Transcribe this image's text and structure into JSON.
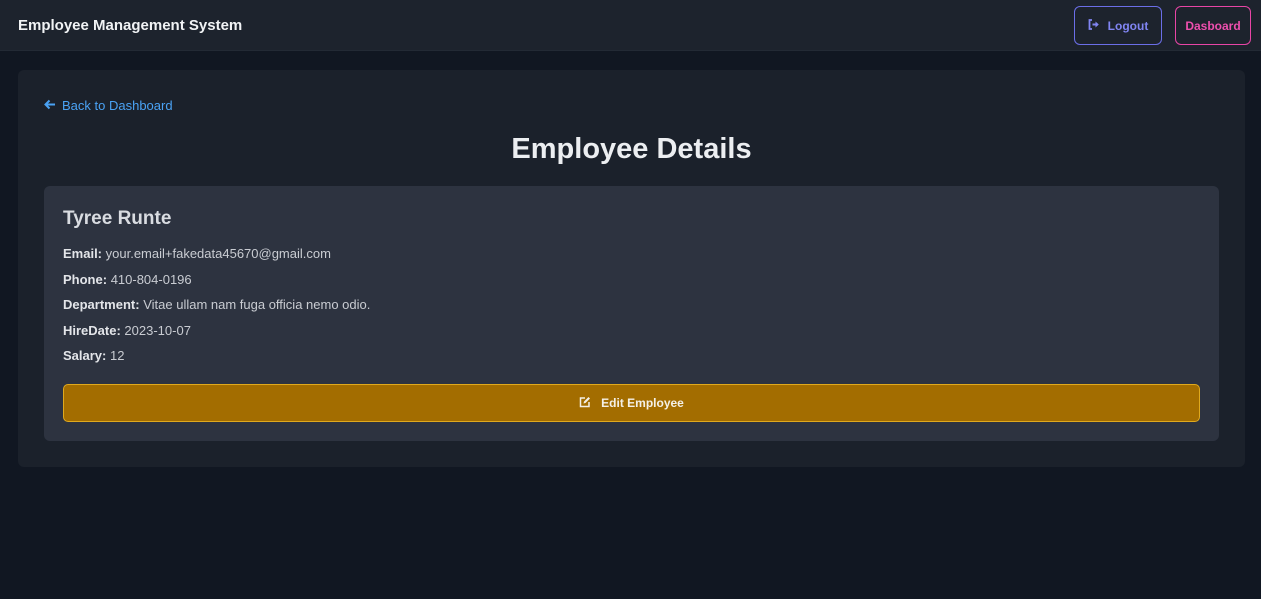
{
  "header": {
    "title": "Employee Management System",
    "logout_label": "Logout",
    "dashboard_label": "Dasboard"
  },
  "main": {
    "back_link": "Back to Dashboard",
    "page_title": "Employee Details",
    "employee": {
      "name": "Tyree Runte",
      "fields": [
        {
          "label": "Email:",
          "value": "your.email+fakedata45670@gmail.com"
        },
        {
          "label": "Phone:",
          "value": "410-804-0196"
        },
        {
          "label": "Department:",
          "value": "Vitae ullam nam fuga officia nemo odio."
        },
        {
          "label": "HireDate:",
          "value": "2023-10-07"
        },
        {
          "label": "Salary:",
          "value": "12"
        }
      ]
    },
    "edit_button_label": "Edit Employee"
  },
  "icons": {
    "logout": "sign-out-icon",
    "back": "arrow-left-icon",
    "edit": "edit-icon"
  },
  "colors": {
    "background": "#111722",
    "navbar": "#1d232d",
    "panel": "#1b212b",
    "card": "#2d3340",
    "logout_accent": "#6b6ee8",
    "dashboard_accent": "#e845a6",
    "link": "#4aa2f4",
    "edit_button": "#a36d00",
    "edit_border": "#e0a91d"
  }
}
